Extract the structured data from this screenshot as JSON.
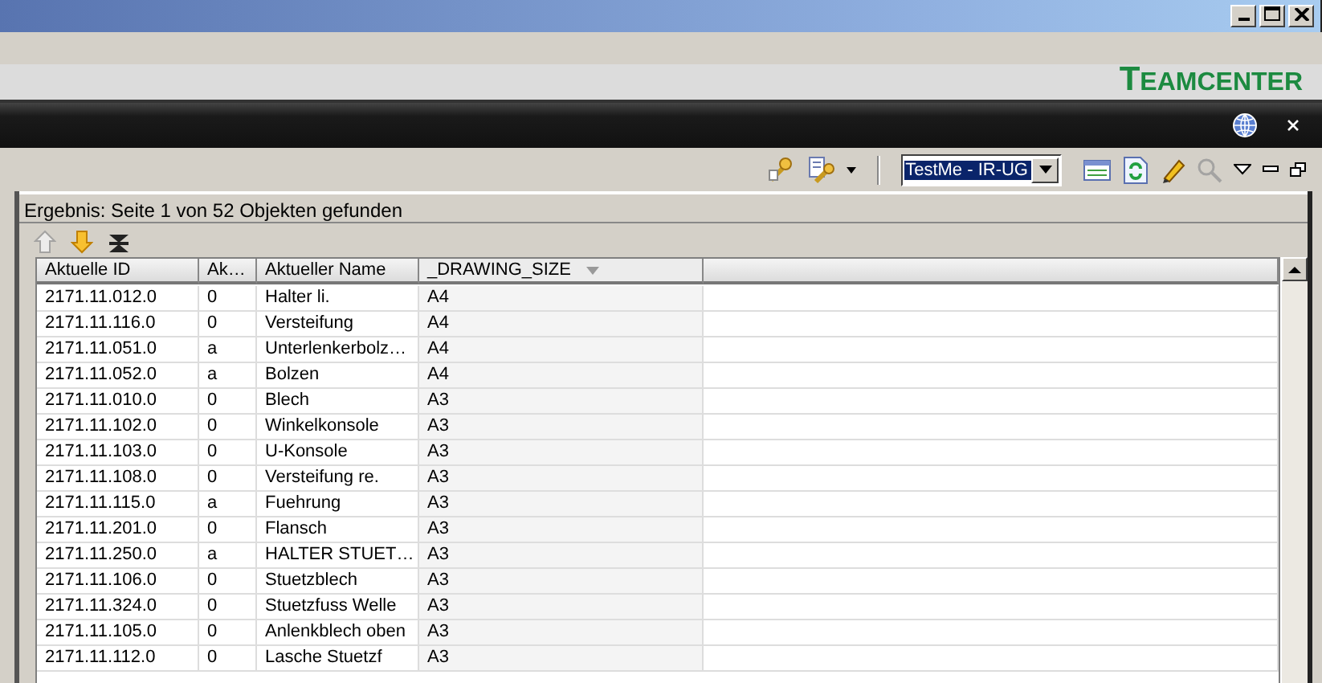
{
  "brand": "TEAMCENTER",
  "toolbar": {
    "combo": {
      "value": "TestMe - IR-UG",
      "selected": true
    },
    "search_disabled": true
  },
  "panel": {
    "title": "Ergebnis: Seite 1 von 52 Objekten gefunden",
    "nav": [
      {
        "kind": "up",
        "disabled": true
      },
      {
        "kind": "down",
        "disabled": false
      },
      {
        "kind": "collapse",
        "disabled": false
      }
    ]
  },
  "table": {
    "columns": [
      {
        "label": "Aktuelle ID",
        "sorted": false
      },
      {
        "label": "Ak…",
        "sorted": false
      },
      {
        "label": "Aktueller Name",
        "sorted": false
      },
      {
        "label": "_DRAWING_SIZE",
        "sorted": true
      }
    ],
    "rows": [
      [
        "2171.11.012.0",
        "0",
        "Halter li.",
        "A4"
      ],
      [
        "2171.11.116.0",
        "0",
        "Versteifung",
        "A4"
      ],
      [
        "2171.11.051.0",
        "a",
        "Unterlenkerbolz…",
        "A4"
      ],
      [
        "2171.11.052.0",
        "a",
        "Bolzen",
        "A4"
      ],
      [
        "2171.11.010.0",
        "0",
        "Blech",
        "A3"
      ],
      [
        "2171.11.102.0",
        "0",
        "Winkelkonsole",
        "A3"
      ],
      [
        "2171.11.103.0",
        "0",
        "U-Konsole",
        "A3"
      ],
      [
        "2171.11.108.0",
        "0",
        "Versteifung re.",
        "A3"
      ],
      [
        "2171.11.115.0",
        "a",
        "Fuehrung",
        "A3"
      ],
      [
        "2171.11.201.0",
        "0",
        "Flansch",
        "A3"
      ],
      [
        "2171.11.250.0",
        "a",
        "HALTER STUET…",
        "A3"
      ],
      [
        "2171.11.106.0",
        "0",
        "Stuetzblech",
        "A3"
      ],
      [
        "2171.11.324.0",
        "0",
        "Stuetzfuss Welle",
        "A3"
      ],
      [
        "2171.11.105.0",
        "0",
        "Anlenkblech oben",
        "A3"
      ],
      [
        "2171.11.112.0",
        "0",
        "Lasche Stuetzf",
        "A3"
      ]
    ]
  }
}
